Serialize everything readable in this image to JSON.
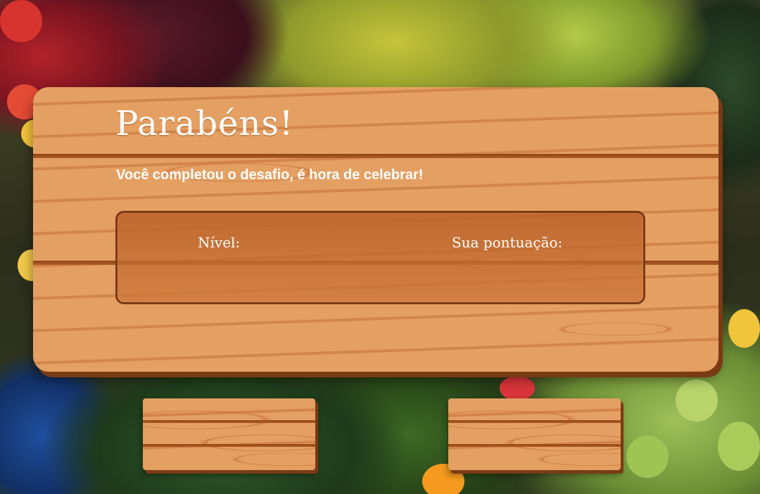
{
  "dialog": {
    "title": "Parabéns!",
    "subtitle": "Você completou o desafio, é hora de celebrar!",
    "level_label": "Nível:",
    "score_label": "Sua pontuação:"
  },
  "buttons": {
    "left_label": "",
    "right_label": ""
  },
  "colors": {
    "wood": "#e4a063",
    "wood_dark": "#7b3a14",
    "text": "#ffffff"
  }
}
